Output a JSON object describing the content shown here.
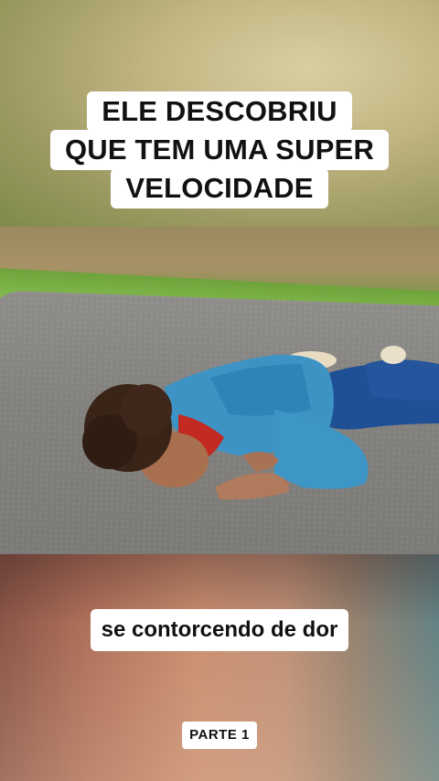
{
  "title_lines": [
    "ELE DESCOBRIU",
    "QUE TEM UMA SUPER",
    "VELOCIDADE"
  ],
  "subtitle": "se contorcendo de dor",
  "part_label": "PARTE 1",
  "scene": {
    "description_icon": "person-lying-on-road"
  }
}
